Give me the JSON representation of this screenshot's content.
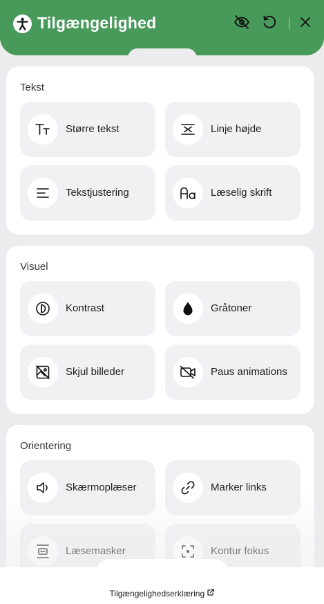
{
  "header": {
    "title": "Tilgængelighed",
    "icons": {
      "logo": "accessibility-person-icon",
      "hide": "eye-off-icon",
      "reset": "rotate-ccw-icon",
      "close": "close-icon"
    },
    "color": "#479a59"
  },
  "sections": [
    {
      "title": "Tekst",
      "items": [
        {
          "label": "Større tekst",
          "icon": "text-size-icon"
        },
        {
          "label": "Linje højde",
          "icon": "line-height-icon"
        },
        {
          "label": "Tekstjustering",
          "icon": "text-align-icon"
        },
        {
          "label": "Læselig skrift",
          "icon": "readable-font-icon"
        }
      ]
    },
    {
      "title": "Visuel",
      "items": [
        {
          "label": "Kontrast",
          "icon": "contrast-icon"
        },
        {
          "label": "Gråtoner",
          "icon": "droplet-icon"
        },
        {
          "label": "Skjul billeder",
          "icon": "image-off-icon"
        },
        {
          "label": "Paus animations",
          "icon": "video-off-icon"
        }
      ]
    },
    {
      "title": "Orientering",
      "items": [
        {
          "label": "Skærmoplæser",
          "icon": "speaker-icon"
        },
        {
          "label": "Marker links",
          "icon": "link-icon"
        },
        {
          "label": "Læsemasker",
          "icon": "reading-mask-icon"
        },
        {
          "label": "Kontur fokus",
          "icon": "focus-icon"
        }
      ]
    }
  ],
  "footer": {
    "link_label": "Tilgængelighedserklæring",
    "icon": "external-link-icon"
  }
}
